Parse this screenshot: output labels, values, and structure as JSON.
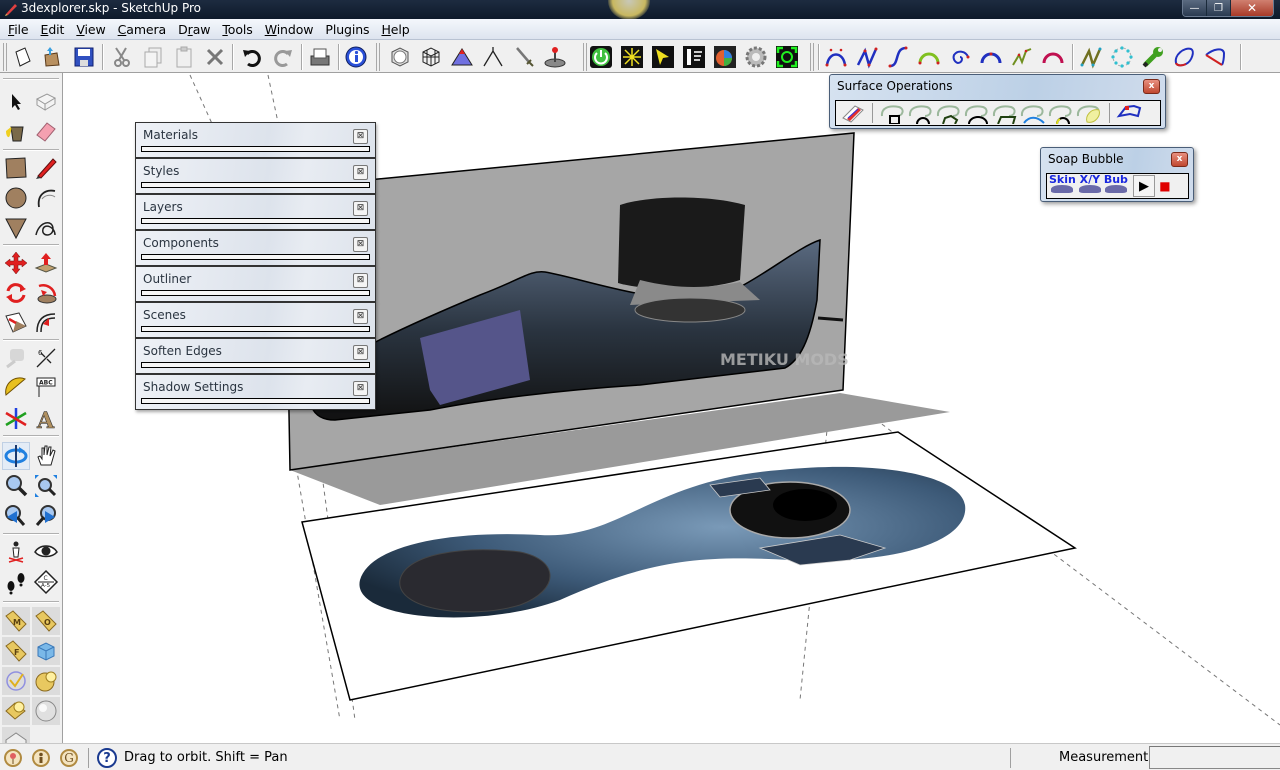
{
  "window": {
    "title": "3dexplorer.skp - SketchUp Pro",
    "controls": {
      "minimize": "—",
      "restore": "❐",
      "close": "✕"
    }
  },
  "menu": [
    {
      "label": "File",
      "accel": "F",
      "rest": "ile"
    },
    {
      "label": "Edit",
      "accel": "E",
      "rest": "dit"
    },
    {
      "label": "View",
      "accel": "V",
      "rest": "iew"
    },
    {
      "label": "Camera",
      "accel": "C",
      "rest": "amera"
    },
    {
      "label": "Draw",
      "pre": "D",
      "accel": "r",
      "rest": "aw"
    },
    {
      "label": "Tools",
      "accel": "T",
      "rest": "ools"
    },
    {
      "label": "Window",
      "accel": "W",
      "rest": "indow"
    },
    {
      "label": "Plugins",
      "pre": "Plugins",
      "accel": "",
      "rest": ""
    },
    {
      "label": "Help",
      "accel": "H",
      "rest": "elp"
    }
  ],
  "toolbar": {
    "standard": [
      "new-icon",
      "open-icon",
      "save-icon",
      "cut-icon",
      "copy-icon",
      "paste-icon",
      "erase-icon",
      "undo-icon",
      "redo-icon",
      "print-icon",
      "model-info-icon"
    ],
    "views": [
      "xray-icon",
      "wireframe-icon",
      "sandbox-icon",
      "sketch-icon",
      "sword-icon",
      "joystick-icon"
    ],
    "plugins": [
      "power-icon",
      "light-icon",
      "select-light-icon",
      "render-icon",
      "color-picker-icon",
      "gear-icon",
      "frame-icon"
    ],
    "bezier": [
      "bezier-curve-icon",
      "polyline-icon",
      "spline-icon",
      "arc-green-icon",
      "spiral-icon",
      "arc-icon",
      "polyline-green-icon",
      "arc-red-icon",
      "polyline-teal-icon",
      "circle-points-icon",
      "wrench-icon",
      "blob-icon",
      "triangle-curve-icon"
    ]
  },
  "left_toolbar": [
    "select-icon",
    "component-icon",
    "paint-bucket-icon",
    "eraser-icon",
    "rectangle-icon",
    "pencil-icon",
    "circle-icon",
    "arc-icon",
    "polygon-icon",
    "freehand-icon",
    "move-icon",
    "push-pull-icon",
    "rotate-icon",
    "follow-me-icon",
    "scale-icon",
    "offset-icon",
    "tape-measure-icon",
    "dimension-icon",
    "protractor-icon",
    "text-icon",
    "axes-icon",
    "3d-text-icon",
    "orbit-icon",
    "pan-icon",
    "zoom-icon",
    "zoom-extents-icon",
    "previous-view-icon",
    "next-view-icon",
    "position-camera-icon",
    "look-around-icon",
    "walk-icon",
    "section-plane-icon",
    "tag-m-icon",
    "tag-o-icon",
    "tag-f-icon",
    "cube-icon",
    "check-circle-icon",
    "bulb-pie-icon",
    "bulb-tag-icon",
    "sphere-icon",
    "envelope-icon"
  ],
  "trays": [
    {
      "label": "Materials"
    },
    {
      "label": "Styles"
    },
    {
      "label": "Layers"
    },
    {
      "label": "Components"
    },
    {
      "label": "Outliner"
    },
    {
      "label": "Scenes"
    },
    {
      "label": "Soften Edges"
    },
    {
      "label": "Shadow Settings"
    }
  ],
  "tray_close_glyph": "⊠",
  "surface_operations": {
    "title": "Surface Operations",
    "close": "x",
    "tools": [
      "surface-eraser-icon",
      "surface-rect-icon",
      "surface-arc-icon",
      "surface-polygon-icon",
      "surface-circle-icon",
      "surface-parallelogram-icon",
      "surface-curve-icon",
      "surface-arc-yellow-icon",
      "surface-offset-icon",
      "surface-outline-icon"
    ]
  },
  "soap_bubble": {
    "title": "Soap Bubble",
    "close": "x",
    "buttons": [
      {
        "label": "Skin"
      },
      {
        "label": "X/Y"
      },
      {
        "label": "Bub"
      }
    ],
    "play": "▶",
    "stop": "■"
  },
  "status": {
    "icons": [
      "geo-location-icon",
      "credits-icon",
      "google-icon"
    ],
    "help": "?",
    "message": "Drag to orbit.  Shift = Pan",
    "measurements_label": "Measurements",
    "measurements_value": ""
  },
  "scene": {
    "watermark": "METIKU MODS",
    "colors": {
      "wall": "#a6a6a6",
      "floor_shadow": "#9a9a9a",
      "device_blue": "#3d5a78",
      "highlight_face": "#55558a"
    }
  }
}
